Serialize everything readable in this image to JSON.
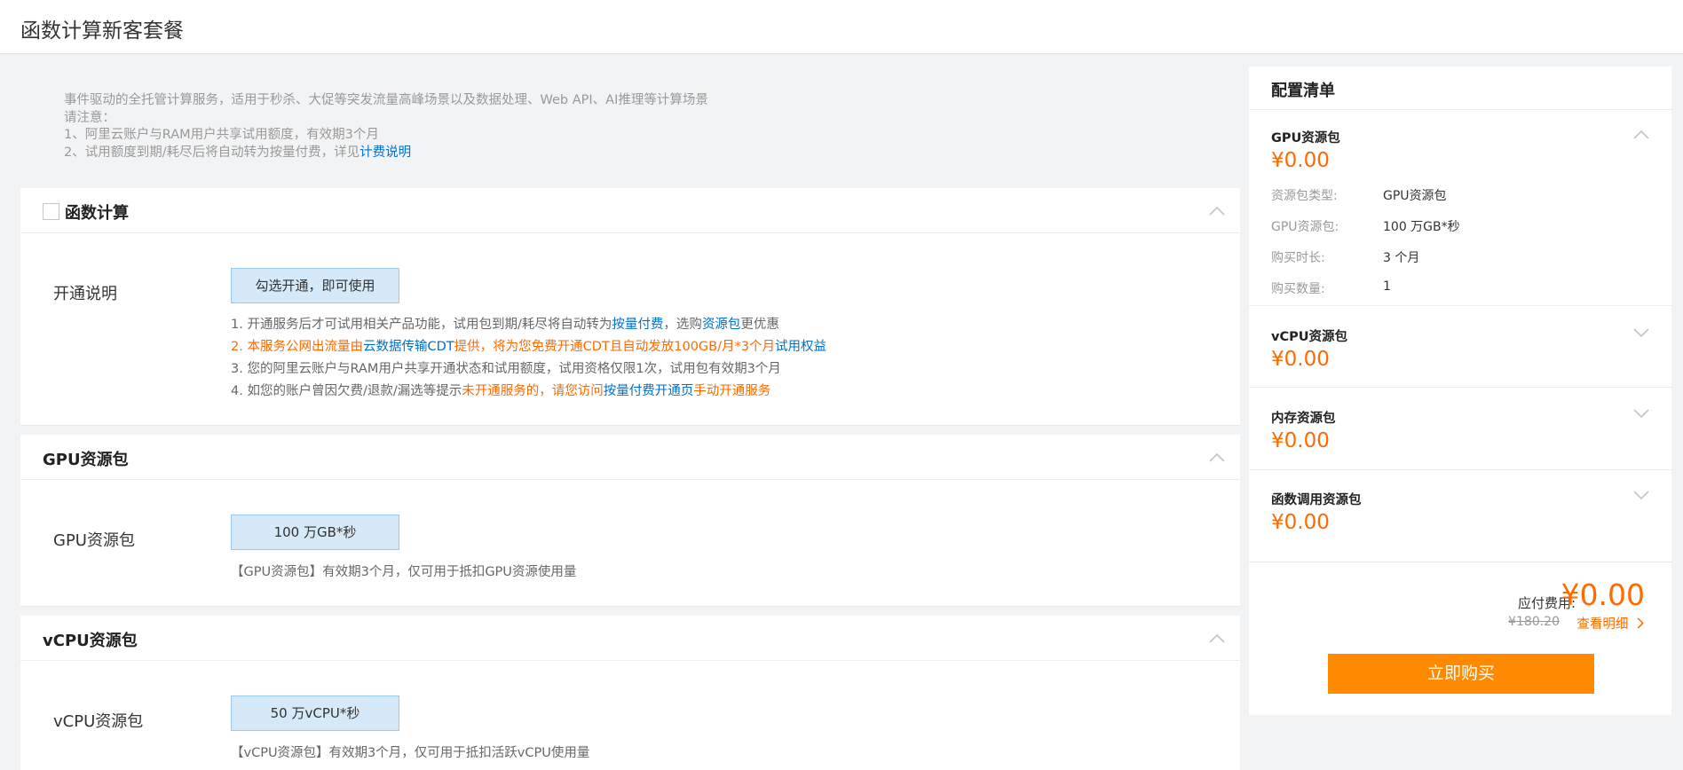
{
  "page": {
    "title": "函数计算新客套餐"
  },
  "intro": {
    "line1": "事件驱动的全托管计算服务，适用于秒杀、大促等突发流量高峰场景以及数据处理、Web API、AI推理等计算场景",
    "line2": "请注意：",
    "line3": "1、阿里云账户与RAM用户共享试用额度，有效期3个月",
    "line4_prefix": "2、试用额度到期/耗尽后将自动转为按量付费，详见",
    "line4_link": "计费说明"
  },
  "function_section": {
    "title": "函数计算",
    "checked": false,
    "row_label": "开通说明",
    "value": "勾选开通，即可使用",
    "notes": {
      "n1a": "1. 开通服务后才可试用相关产品功能，试用包到期/耗尽将自动转为",
      "n1b": "按量付费",
      "n1c": "，选购",
      "n1d": "资源包",
      "n1e": "更优惠",
      "n2a": "2. 本服务公网出流量由",
      "n2b": "云数据传输CDT",
      "n2c": "提供，将为您免费开通CDT且自动发放100GB/月*3个月",
      "n2d": "试用权益",
      "n3": "3. 您的阿里云账户与RAM用户共享开通状态和试用额度，试用资格仅限1次，试用包有效期3个月",
      "n4a": "4. 如您的账户曾因欠费/退款/漏选等提示",
      "n4b": "未开通服务的，请您访问",
      "n4c": "按量付费开通页",
      "n4d": "手动开通服务"
    }
  },
  "gpu_section": {
    "title": "GPU资源包",
    "row_label": "GPU资源包",
    "value": "100 万GB*秒",
    "note": "【GPU资源包】有效期3个月，仅可用于抵扣GPU资源使用量"
  },
  "vcpu_section": {
    "title": "vCPU资源包",
    "row_label": "vCPU资源包",
    "value": "50 万vCPU*秒",
    "note": "【vCPU资源包】有效期3个月，仅可用于抵扣活跃vCPU使用量"
  },
  "config": {
    "title": "配置清单",
    "packages": [
      {
        "name": "GPU资源包",
        "price": "¥0.00",
        "expanded": true,
        "details": [
          {
            "label": "资源包类型:",
            "value": "GPU资源包"
          },
          {
            "label": "GPU资源包:",
            "value": "100 万GB*秒"
          },
          {
            "label": "购买时长:",
            "value": "3 个月"
          },
          {
            "label": "购买数量:",
            "value": "1"
          }
        ]
      },
      {
        "name": "vCPU资源包",
        "price": "¥0.00",
        "expanded": false
      },
      {
        "name": "内存资源包",
        "price": "¥0.00",
        "expanded": false
      },
      {
        "name": "函数调用资源包",
        "price": "¥0.00",
        "expanded": false
      }
    ],
    "pay_label": "应付费用:",
    "pay_total": "¥0.00",
    "original_price": "¥180.20",
    "detail_link": "查看明细",
    "buy_label": "立即购买"
  },
  "colors": {
    "accent": "#ff6a00",
    "button": "#ff8a00",
    "link": "#0070cc",
    "value_box": "#d6e9f8"
  },
  "icons": {
    "collapse": "chevron-up-icon",
    "expand": "chevron-down-icon",
    "detail": "chevron-right-icon"
  }
}
